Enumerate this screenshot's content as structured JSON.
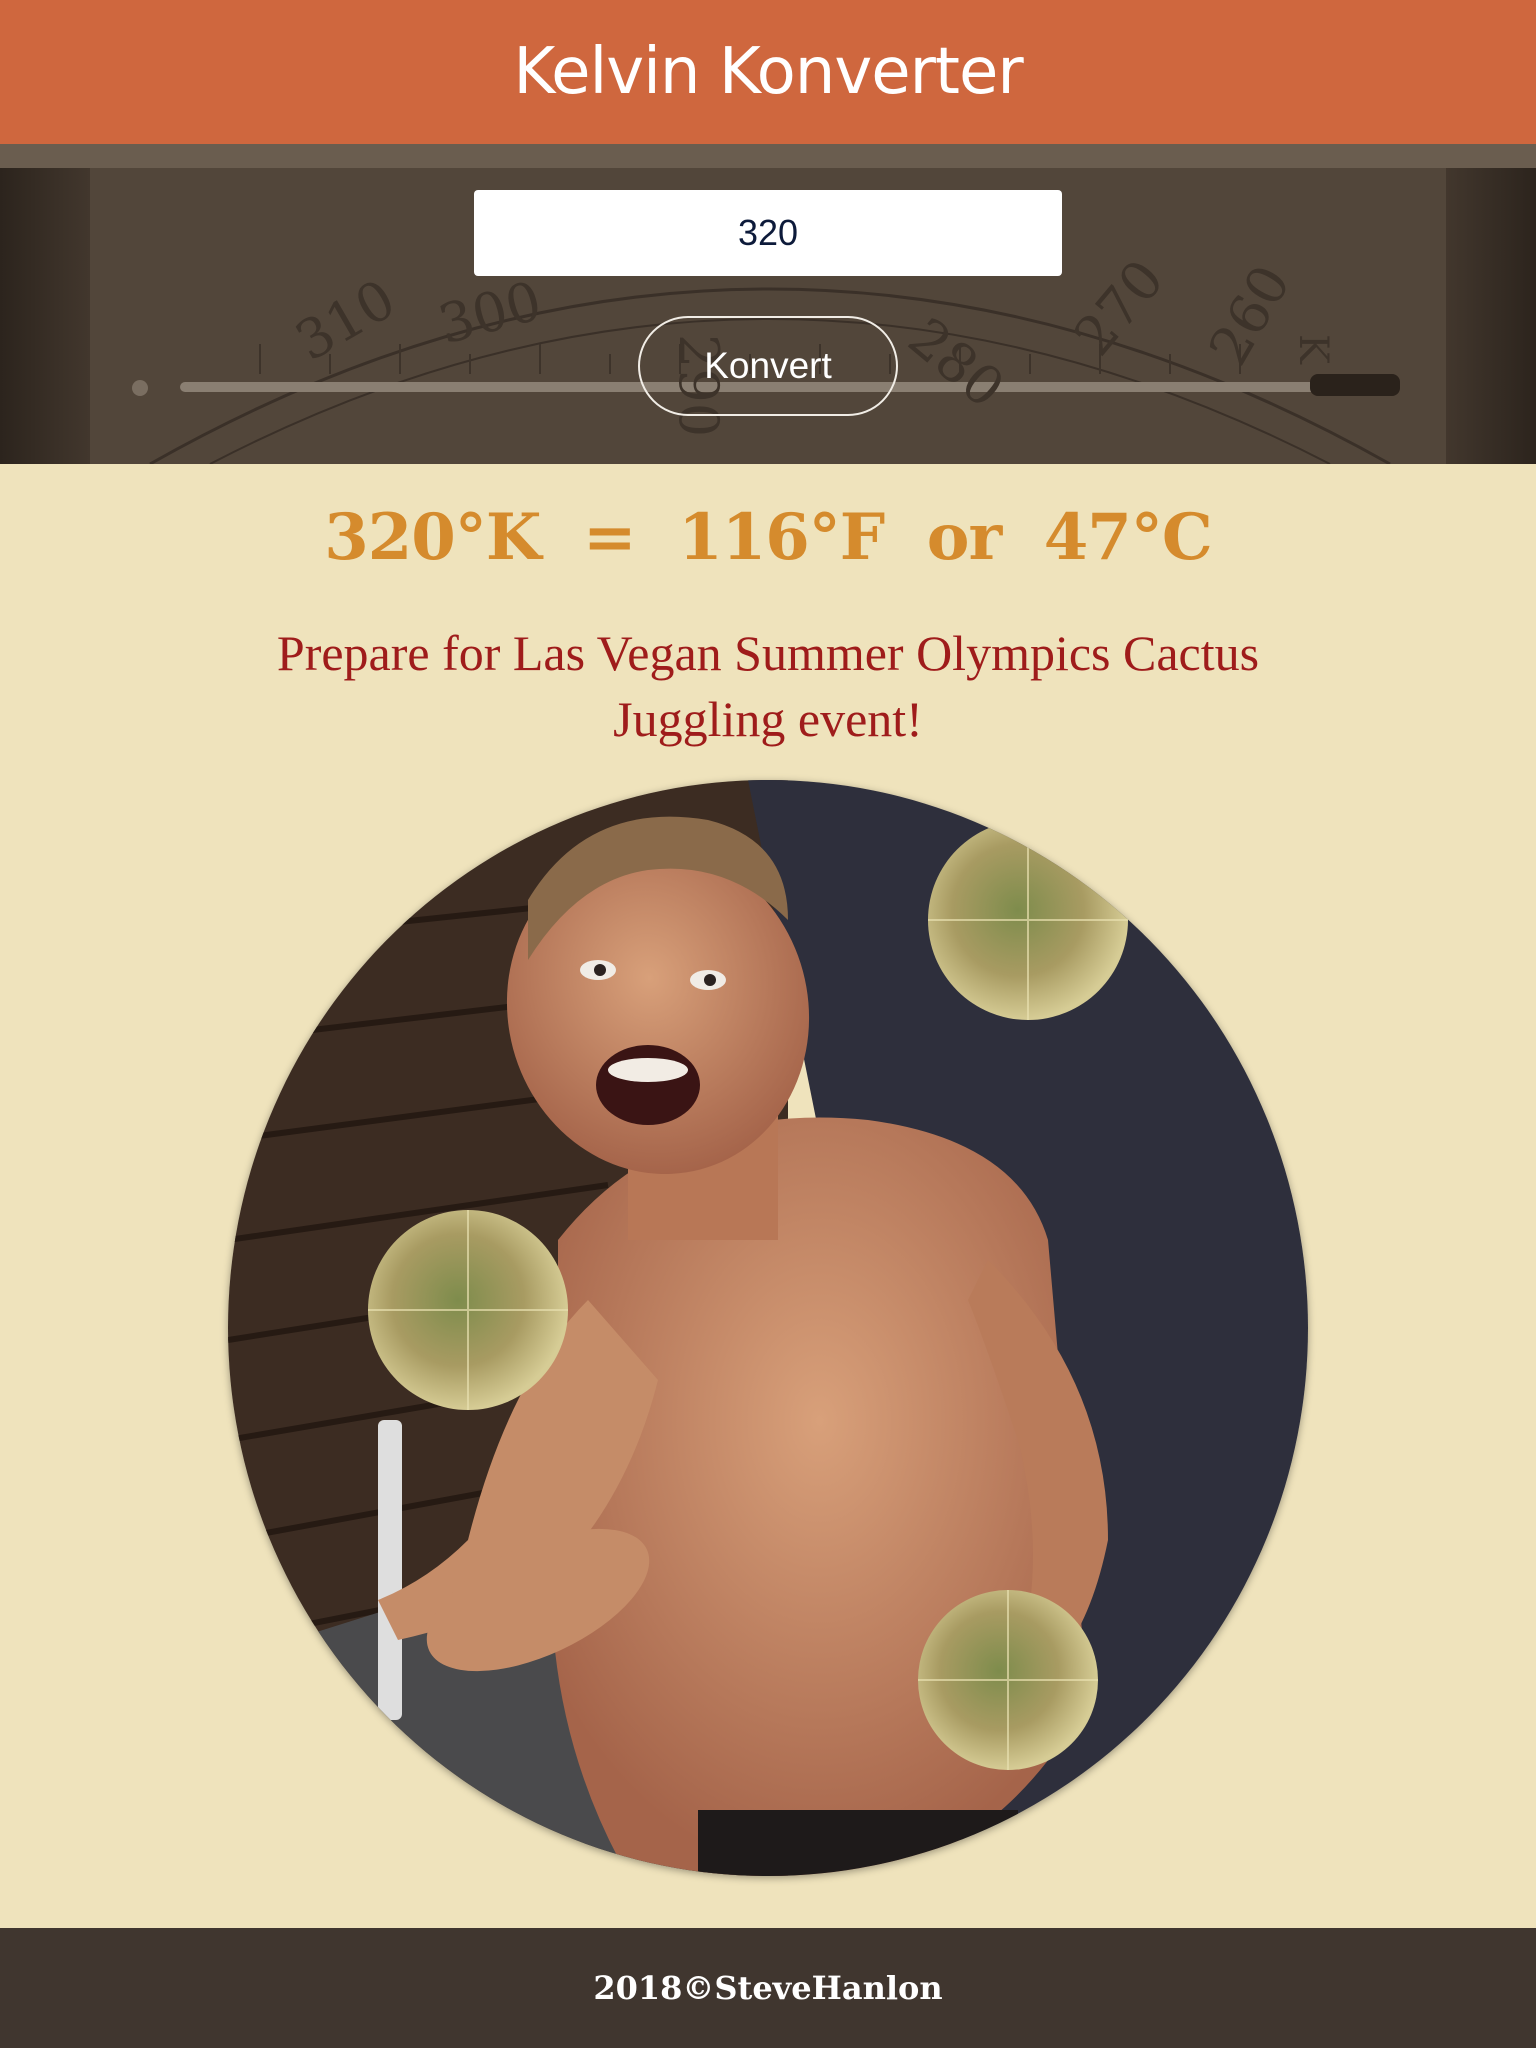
{
  "header": {
    "title": "Kelvin Konverter"
  },
  "form": {
    "kelvin_value": "320",
    "button_label": "Konvert"
  },
  "result": {
    "text": "320°K  =  116°F  or  47°C"
  },
  "message": "Prepare for Las Vegan Summer Olympics Cactus Juggling event!",
  "hero": {
    "scale_labels": [
      "310",
      "300",
      "290",
      "280",
      "270",
      "260",
      "K"
    ]
  },
  "image": {
    "subject": "cactus-juggler-photo"
  },
  "footer": {
    "copyright": "2018©SteveHanlon"
  },
  "colors": {
    "header_bg": "#cf673e",
    "page_bg": "#efe3bc",
    "result_text": "#d58b2d",
    "message_text": "#9f1c1b",
    "footer_bg": "#40362f"
  }
}
